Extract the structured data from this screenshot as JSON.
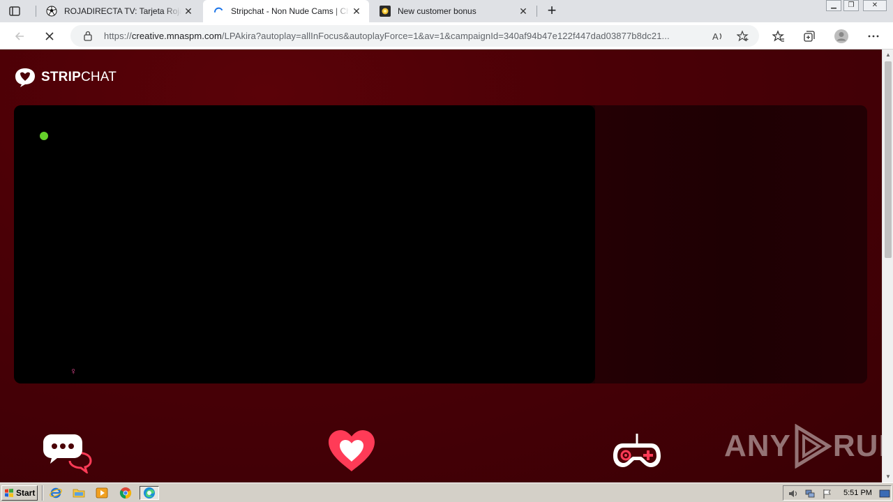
{
  "browser": {
    "tabs": [
      {
        "title": "ROJADIRECTA TV: Tarjeta Roja TV",
        "favicon": "soccer-ball-icon",
        "active": false
      },
      {
        "title": "Stripchat - Non Nude Cams | Chat",
        "favicon": "loading-spinner-icon",
        "active": true
      },
      {
        "title": "New customer bonus",
        "favicon": "bonus-sun-icon",
        "active": false
      }
    ],
    "tab_close_glyph": "✕",
    "new_tab_glyph": "+",
    "address": {
      "scheme": "https://",
      "host": "creative.mnaspm.com",
      "path": "/LPAkira?autoplay=allInFocus&autoplayForce=1&av=1&campaignId=340af94b47e122f447dad03877b8dc21...",
      "read_aloud_glyph": "Ă"
    }
  },
  "page": {
    "logo": {
      "bold": "STRIP",
      "regular": "CHAT"
    },
    "stage": {
      "live_indicator_color": "#65d12a",
      "gender_glyph": "♀"
    },
    "features": [
      "chat-bubbles-icon",
      "heart-icon",
      "gamepad-icon"
    ],
    "accent_color": "#ff3b57",
    "watermark": {
      "left": "ANY",
      "right": "RUN"
    }
  },
  "taskbar": {
    "start_label": "Start",
    "clock": "5:51 PM"
  }
}
